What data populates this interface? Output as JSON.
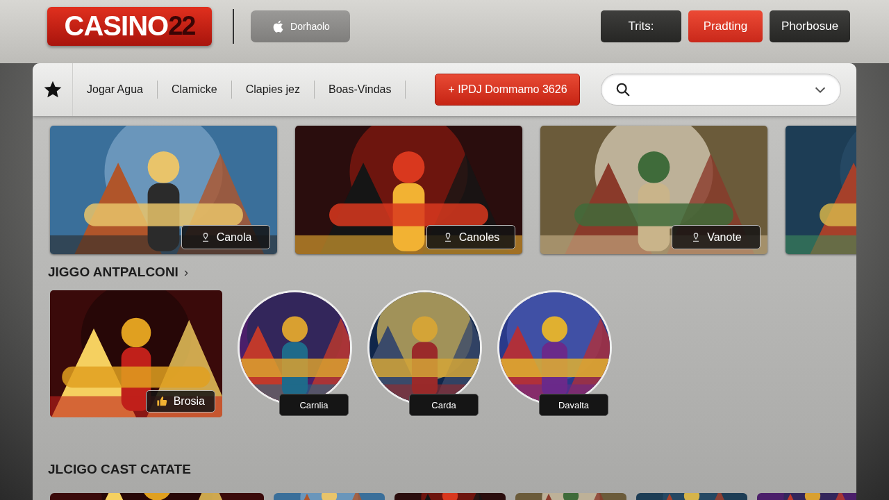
{
  "header": {
    "logo": {
      "text": "CASINO",
      "number": "22"
    },
    "app_button": {
      "label": "Dorhaolo"
    },
    "buttons": [
      {
        "label": "Trits:",
        "kind": "dark"
      },
      {
        "label": "Pradting",
        "kind": "red"
      },
      {
        "label": "Phorbosue",
        "kind": "dark"
      }
    ]
  },
  "nav": {
    "items": [
      {
        "label": "Jogar Agua"
      },
      {
        "label": "Clamicke"
      },
      {
        "label": "Clapies jez"
      },
      {
        "label": "Boas-Vindas"
      }
    ],
    "promo_button": {
      "label": "+ IPDJ Dommamo 3626"
    },
    "search": {
      "expanded": false
    }
  },
  "banners": [
    {
      "kind": "picture",
      "label": "Canola"
    },
    {
      "kind": "picture",
      "label": "Canoles"
    },
    {
      "kind": "picture",
      "label": "Vanote"
    },
    {
      "kind": "picture"
    }
  ],
  "sections": [
    {
      "title": "JIGGO ANTPALCONI",
      "arrow": "›",
      "games": [
        {
          "kind": "bonus",
          "label": "Brosia"
        },
        {
          "kind": "round",
          "label": "Carnlia"
        },
        {
          "kind": "round",
          "label": "Carda"
        },
        {
          "kind": "round",
          "label": "Davalta"
        }
      ]
    },
    {
      "title": "JLCIGO CAST CATATE",
      "games": [
        {
          "kind": "strip"
        },
        {
          "kind": "strip"
        },
        {
          "kind": "strip"
        },
        {
          "kind": "strip"
        },
        {
          "kind": "strip"
        },
        {
          "kind": "strip"
        }
      ]
    }
  ]
}
